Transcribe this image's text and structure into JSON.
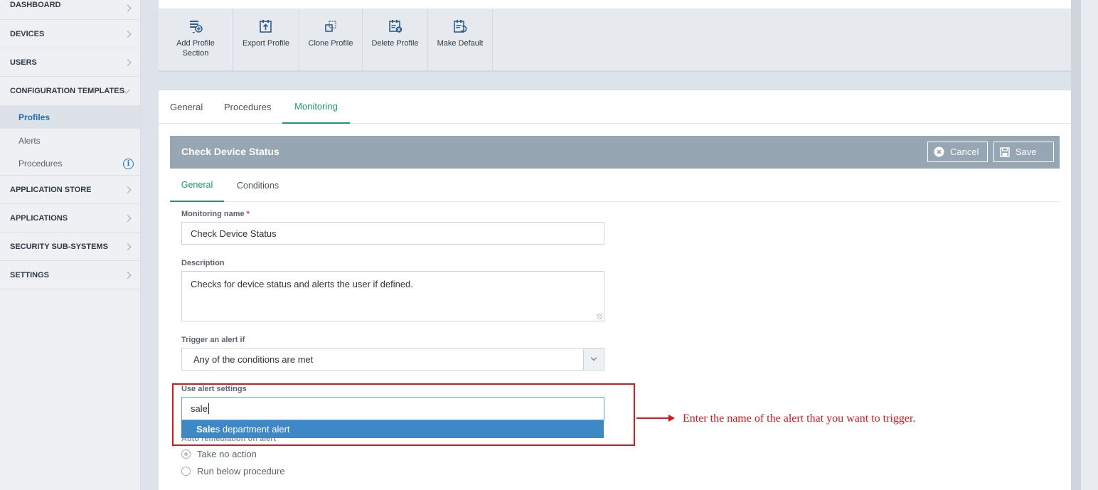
{
  "sidebar": {
    "items": [
      {
        "label": "DASHBOARD"
      },
      {
        "label": "DEVICES"
      },
      {
        "label": "USERS"
      },
      {
        "label": "CONFIGURATION TEMPLATES"
      },
      {
        "label": "APPLICATION STORE"
      },
      {
        "label": "APPLICATIONS"
      },
      {
        "label": "SECURITY SUB-SYSTEMS"
      },
      {
        "label": "SETTINGS"
      }
    ],
    "subitems": [
      {
        "label": "Profiles",
        "active": true
      },
      {
        "label": "Alerts"
      },
      {
        "label": "Procedures",
        "icon": "info-icon"
      }
    ]
  },
  "toolbar": {
    "buttons": [
      {
        "label_line1": "Add Profile",
        "label_line2": "Section",
        "icon": "add-section-icon"
      },
      {
        "label": "Export Profile",
        "icon": "export-icon"
      },
      {
        "label": "Clone Profile",
        "icon": "clone-icon"
      },
      {
        "label": "Delete Profile",
        "icon": "delete-icon"
      },
      {
        "label": "Make Default",
        "icon": "make-default-icon"
      }
    ]
  },
  "tabs": [
    "General",
    "Procedures",
    "Monitoring"
  ],
  "panel": {
    "title": "Check Device Status",
    "cancel_label": "Cancel",
    "save_label": "Save",
    "subtabs": [
      "General",
      "Conditions"
    ]
  },
  "form": {
    "monitoring_name_label": "Monitoring name",
    "required_mark": "*",
    "monitoring_name_value": "Check Device Status",
    "description_label": "Description",
    "description_value": "Checks for device status and alerts the user if defined.",
    "trigger_label": "Trigger an alert if",
    "trigger_value": "Any of the conditions are met",
    "alert_settings_label": "Use alert settings",
    "alert_settings_value": "sale",
    "suggestion_match": "Sale",
    "suggestion_rest": "s department alert",
    "auto_remediation_label": "Auto remediation on alert",
    "radio_options": [
      "Take no action",
      "Run below procedure"
    ]
  },
  "annotation": {
    "text": "Enter the name of the alert that you want to trigger."
  },
  "colors": {
    "accent_green": "#1a9c6c",
    "panel_header": "#96a6b3",
    "suggestion_blue": "#3f88c8",
    "annotation_red": "#e0161b"
  }
}
